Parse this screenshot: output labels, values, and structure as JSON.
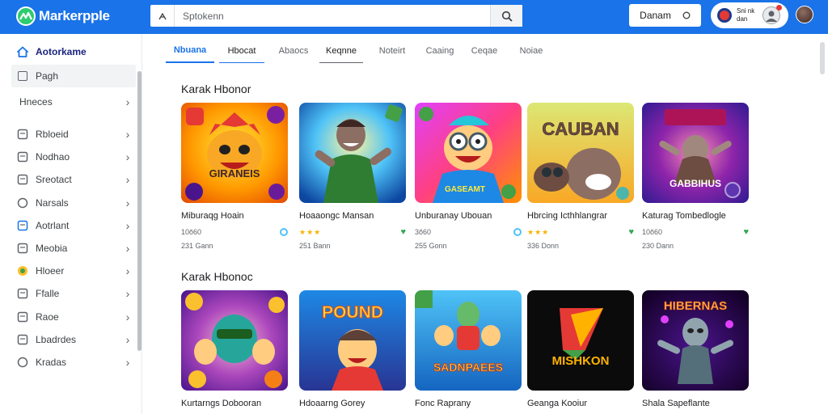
{
  "app": {
    "name": "Markerpple",
    "search_placeholder": "Sptokenn",
    "action_label": "Danam",
    "account_line1": "Sni nk",
    "account_line2": "dan"
  },
  "sidebar": {
    "home_label": "Aotorkame",
    "selected_label": "Pagh",
    "group_label": "Hneces",
    "items": [
      {
        "label": "Rbloeid"
      },
      {
        "label": "Nodhao"
      },
      {
        "label": "Sreotact"
      },
      {
        "label": "Narsals"
      },
      {
        "label": "Aotrlant"
      },
      {
        "label": "Meobia"
      },
      {
        "label": "Hloeer"
      },
      {
        "label": "Ffalle"
      },
      {
        "label": "Raoe"
      },
      {
        "label": "Lbadrdes"
      },
      {
        "label": "Kradas"
      }
    ]
  },
  "tabs": [
    "Nbuana",
    "Hbocat",
    "Abaocs",
    "Keqnne",
    "Noteirt",
    "Caaing",
    "Ceqae",
    "Noiae"
  ],
  "sections": [
    {
      "title": "Karak Hbonor",
      "cards": [
        {
          "art_text": "GIRANEIS",
          "title": "Miburaqg Hoain",
          "meta": "10ŏ60",
          "stars": "",
          "sub": "231 Gann",
          "badge": "ring"
        },
        {
          "art_text": "",
          "title": "Hoaaongc Mansan",
          "meta": "",
          "stars": "★★★",
          "sub": "251 Bann",
          "badge": "heart"
        },
        {
          "art_text": "GASEAMT",
          "title": "Unburanay Ubouan",
          "meta": "3ŏ60",
          "stars": "",
          "sub": "255 Gonn",
          "badge": "ring"
        },
        {
          "art_text": "CAUBAN",
          "title": "Hbrcing Icthhlangrar",
          "meta": "",
          "stars": "★★★",
          "sub": "336 Donn",
          "badge": "heart"
        },
        {
          "art_text": "GABBIHUS",
          "title": "Katurag Tombedlogle",
          "meta": "10ŏ60",
          "stars": "",
          "sub": "230 Dann",
          "badge": "heart"
        }
      ]
    },
    {
      "title": "Karak Hbonoc",
      "cards": [
        {
          "art_text": "",
          "title": "Kurtarngs Dobooran"
        },
        {
          "art_text": "POUND",
          "title": "Hdoaarng Gorey"
        },
        {
          "art_text": "SADNPAEES",
          "title": "Fonc Raprany"
        },
        {
          "art_text": "MISHKON",
          "title": "Geanga Kooiur"
        },
        {
          "art_text": "HIBERNAS",
          "title": "Shala Sapeflante"
        }
      ]
    }
  ],
  "colors": {
    "header_blue": "#1a73e8",
    "logo_green": "#2ecc71",
    "star_gold": "#f4b400",
    "heart_green": "#34a853"
  }
}
